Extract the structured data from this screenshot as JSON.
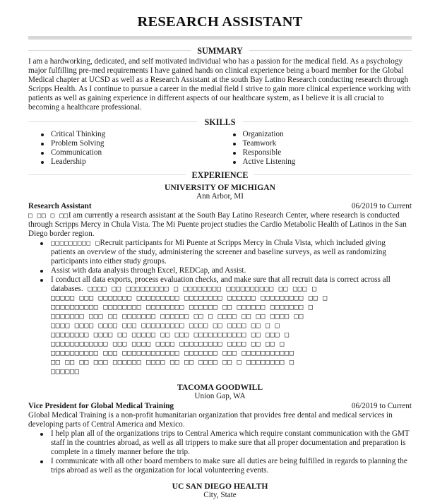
{
  "header": {
    "name": "RESEARCH ASSISTANT"
  },
  "sections": {
    "summary": {
      "title": "SUMMARY",
      "text": "I am a hardworking, dedicated, and self motivated individual who has a passion for the medical field. As a psychology major fulfilling pre-med requirements I have gained hands on clinical experience being a board member for the Global Medical chapter at UCSD as well as a Research Assistant at the south Bay Latino Research conducting research through Scripps Health. As I continue to pursue a career in the medial field I strive to gain more clinical experience working with patients as well as gaining experience in different aspects of our healthcare system, as I believe it is all crucial to becoming a healthcare professional."
    },
    "skills": {
      "title": "SKILLS",
      "column_1": [
        "Critical Thinking",
        "Problem Solving",
        "Communication",
        "Leadership"
      ],
      "column_2": [
        "Organization",
        "Teamwork",
        "Responsible",
        "Active Listening"
      ]
    },
    "experience": {
      "title": "EXPERIENCE",
      "jobs": [
        {
          "company": "UNIVERSITY OF MICHIGAN",
          "location": "Ann Arbor, MI",
          "role": "Research Assistant",
          "dates": "06/2019 to Current",
          "description_prefix": "□ □□ □ □□",
          "description": "I am currently a research assistant at the South Bay Latino Research Center, where research is conducted through Scripps Mercy in Chula Vista. The Mi Puente project studies the Cardio Metabolic Health of Latinos in the San Diego border region.",
          "bullets": [
            {
              "prefix": "□□□□□□□□□ □",
              "text": "Recruit participants for Mi Puente at Scripps Mercy in Chula Vista, which included giving patients an overview of the study, administering the screener and baseline surveys, as well as randomizing participants into either study groups."
            },
            {
              "prefix": "",
              "text": "Assist with data analysis through Excel, REDCap, and Assist."
            },
            {
              "prefix": "",
              "text": "I conduct all data exports, process evaluation checks, and make sure that all recruit data is correct across all databases.",
              "garbled_suffix": " □□□□ □□ □□□□□□□□□ □ □□□□□□□□ □□□□□□□□□□ □□ □□□ □\n□□□□□ □□□ □□□□□□□ □□□□□□□□□ □□□□□□□□ □□□□□□ □□□□□□□□□ □□ □\n□□□□□□□□□□ □□□□□□□□ □□□□□□□□ □□□□□□ □□ □□□□□□ □□□□□□□ □\n□□□□□□□ □□□ □□ □□□□□□□ □□□□□□ □□ □ □□□□ □□ □□ □□□□ □□\n□□□□ □□□□ □□□□ □□□ □□□□□□□□□ □□□□ □□ □□□□ □□ □ □\n□□□□□□□□ □□□□ □□ □□□□□ □□ □□□ □□□□□□□□□□□ □□ □□□ □\n□□□□□□□□□□□□ □□□ □□□□ □□□□ □□□□□□□□□ □□□□ □□ □□ □\n□□□□□□□□□□ □□□ □□□□□□□□□□□□ □□□□□□□ □□□ □□□□□□□□□□□\n□□ □□ □□ □□□ □□□□□□ □□□□ □□ □□ □□□□ □□ □ □□□□□□□□ □\n□□□□□□"
            }
          ]
        },
        {
          "company": "TACOMA GOODWILL",
          "location": "Union Gap, WA",
          "role": "Vice President for Global Medical Training",
          "dates": "06/2019 to Current",
          "description_prefix": "",
          "description": "Global Medical Training is a non-profit humanitarian organization that provides free dental and medical services in developing parts of Central America and Mexico.",
          "bullets": [
            {
              "prefix": "",
              "text": "I help plan all of the organizations trips to Central America which require constant communication with the GMT staff in the countries abroad, as well as all trippers to make sure that all proper documentation and preparation is complete in a timely manner before the trip."
            },
            {
              "prefix": "",
              "text": "I communicate with all other board members to make sure all duties are being fulfilled in regards to planning the trips abroad as well as the organization for local volunteering events."
            }
          ]
        },
        {
          "company": "UC SAN DIEGO HEALTH",
          "location": "City, State"
        }
      ]
    }
  }
}
